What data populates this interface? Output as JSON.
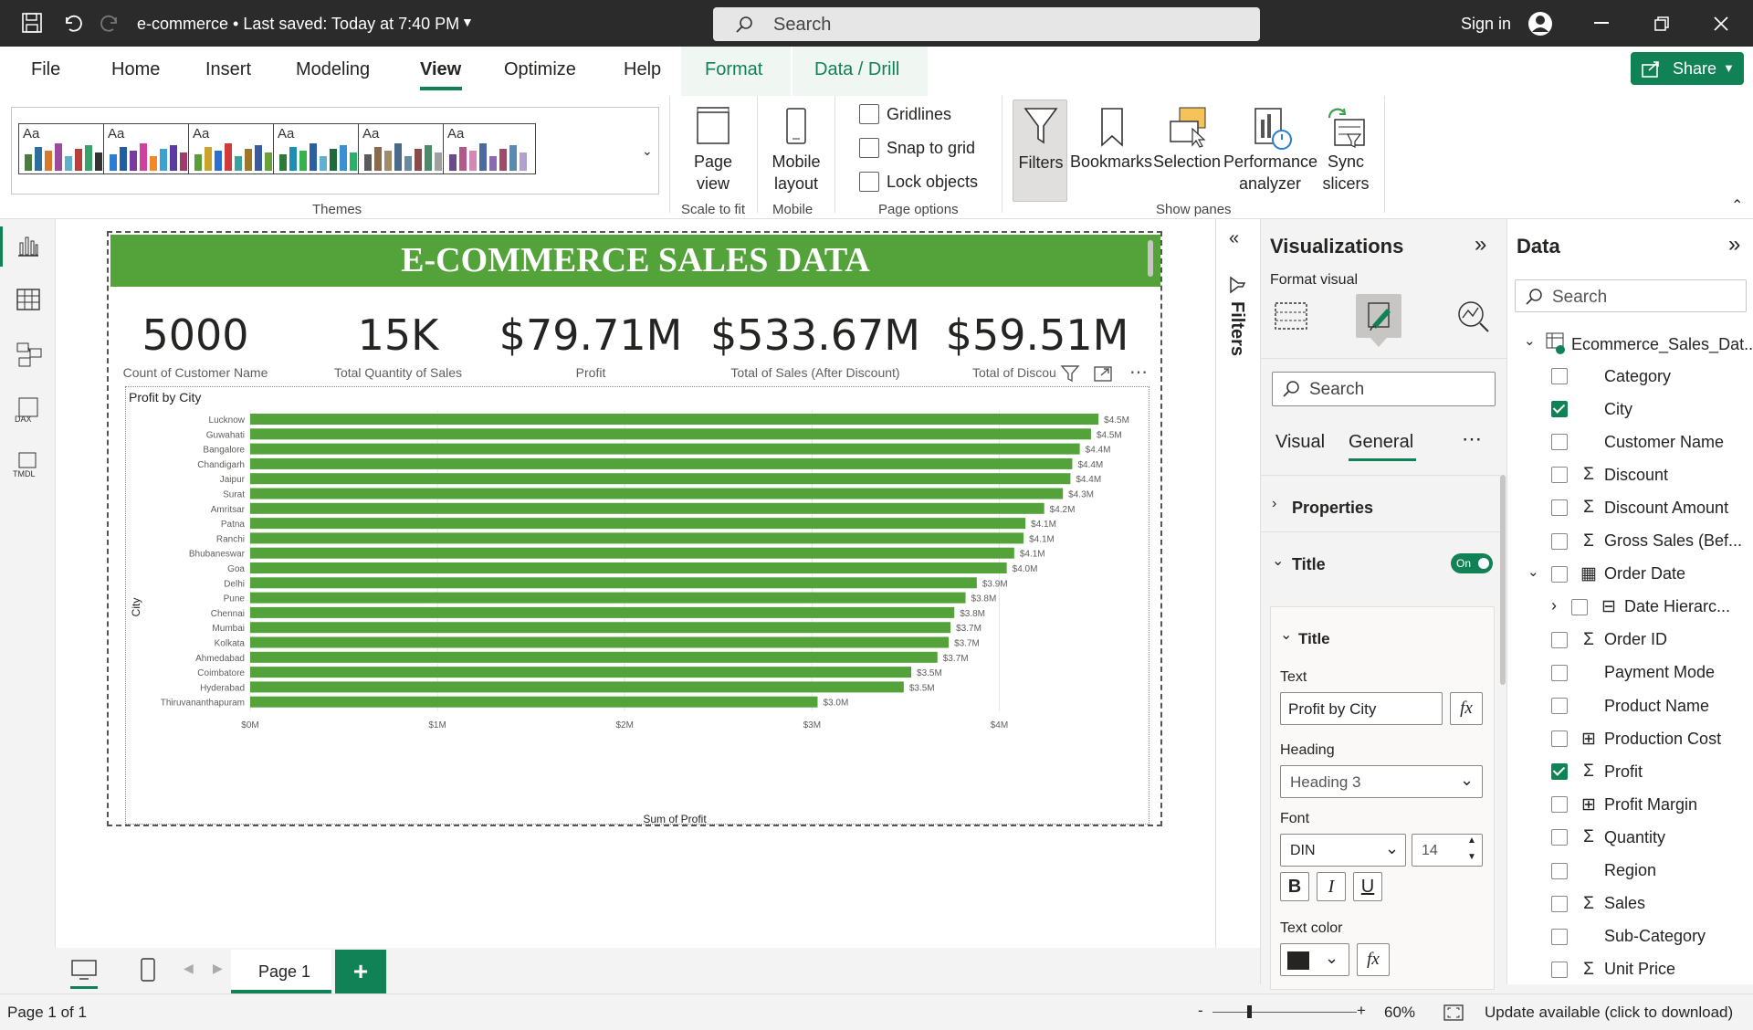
{
  "titlebar": {
    "doc_title": "e-commerce • Last saved: Today at 7:40 PM",
    "search_placeholder": "Search",
    "sign_in": "Sign in"
  },
  "menu": {
    "items": [
      "File",
      "Home",
      "Insert",
      "Modeling",
      "View",
      "Optimize",
      "Help",
      "Format",
      "Data / Drill"
    ],
    "active": "View",
    "share": "Share"
  },
  "ribbon": {
    "themes_label": "Themes",
    "page_view": "Page view",
    "scale_to_fit": "Scale to fit",
    "mobile_layout": "Mobile layout",
    "mobile": "Mobile",
    "gridlines": "Gridlines",
    "snap_to_grid": "Snap to grid",
    "lock_objects": "Lock objects",
    "page_options": "Page options",
    "filters": "Filters",
    "bookmarks": "Bookmarks",
    "selection": "Selection",
    "performance_analyzer": "Performance analyzer",
    "sync_slicers": "Sync slicers",
    "show_panes": "Show panes",
    "theme_aa": "Aa"
  },
  "report": {
    "banner": "E-COMMERCE SALES DATA",
    "cards": [
      {
        "value": "5000",
        "label": "Count of Customer Name"
      },
      {
        "value": "15K",
        "label": "Total Quantity of Sales"
      },
      {
        "value": "$79.71M",
        "label": "Profit"
      },
      {
        "value": "$533.67M",
        "label": "Total of Sales (After Discount)"
      },
      {
        "value": "$59.51M",
        "label": "Total of Discou"
      }
    ]
  },
  "chart_data": {
    "type": "bar",
    "orientation": "horizontal",
    "title": "Profit by City",
    "xlabel": "Sum of Profit",
    "ylabel": "City",
    "xlim": [
      0,
      4.5
    ],
    "x_unit": "$M",
    "x_ticks": [
      "$0M",
      "$1M",
      "$2M",
      "$3M",
      "$4M"
    ],
    "categories": [
      "Lucknow",
      "Guwahati",
      "Bangalore",
      "Chandigarh",
      "Jaipur",
      "Surat",
      "Amritsar",
      "Patna",
      "Ranchi",
      "Bhubaneswar",
      "Goa",
      "Delhi",
      "Pune",
      "Chennai",
      "Mumbai",
      "Kolkata",
      "Ahmedabad",
      "Coimbatore",
      "Hyderabad",
      "Thiruvananthapuram"
    ],
    "values": [
      4.53,
      4.49,
      4.43,
      4.39,
      4.38,
      4.34,
      4.24,
      4.14,
      4.13,
      4.08,
      4.04,
      3.88,
      3.82,
      3.76,
      3.74,
      3.73,
      3.67,
      3.53,
      3.49,
      3.03
    ],
    "data_labels": [
      "$4.5M",
      "$4.5M",
      "$4.4M",
      "$4.4M",
      "$4.4M",
      "$4.3M",
      "$4.2M",
      "$4.1M",
      "$4.1M",
      "$4.1M",
      "$4.0M",
      "$3.9M",
      "$3.8M",
      "$3.8M",
      "$3.7M",
      "$3.7M",
      "$3.7M",
      "$3.5M",
      "$3.5M",
      "$3.0M"
    ],
    "bar_color": "#53a23a",
    "grid": true
  },
  "filters_strip": {
    "label": "Filters"
  },
  "viz": {
    "title": "Visualizations",
    "format_visual": "Format visual",
    "search_placeholder": "Search",
    "tab_visual": "Visual",
    "tab_general": "General",
    "properties": "Properties",
    "title_section": "Title",
    "toggle": "On",
    "sub_title": "Title",
    "text_label": "Text",
    "text_value": "Profit by City",
    "heading_label": "Heading",
    "heading_value": "Heading 3",
    "font_label": "Font",
    "font_value": "DIN",
    "font_size": "14",
    "bold": "B",
    "italic": "I",
    "underline": "U",
    "text_color_label": "Text color",
    "fx": "fx",
    "text_color": "#252423"
  },
  "data_pane": {
    "title": "Data",
    "search_placeholder": "Search",
    "table": "Ecommerce_Sales_Dat...",
    "fields": [
      {
        "name": "Category",
        "icon": "",
        "checked": false
      },
      {
        "name": "City",
        "icon": "",
        "checked": true
      },
      {
        "name": "Customer Name",
        "icon": "",
        "checked": false
      },
      {
        "name": "Discount",
        "icon": "sigma",
        "checked": false
      },
      {
        "name": "Discount Amount",
        "icon": "sigma",
        "checked": false
      },
      {
        "name": "Gross Sales (Bef...",
        "icon": "sigma",
        "checked": false
      },
      {
        "name": "Order Date",
        "icon": "calendar",
        "checked": false
      },
      {
        "name": "Date Hierarc...",
        "icon": "hierarchy",
        "checked": false
      },
      {
        "name": "Order ID",
        "icon": "sigma",
        "checked": false
      },
      {
        "name": "Payment Mode",
        "icon": "",
        "checked": false
      },
      {
        "name": "Product Name",
        "icon": "",
        "checked": false
      },
      {
        "name": "Production Cost",
        "icon": "calc",
        "checked": false
      },
      {
        "name": "Profit",
        "icon": "sigma",
        "checked": true
      },
      {
        "name": "Profit Margin",
        "icon": "calc",
        "checked": false
      },
      {
        "name": "Quantity",
        "icon": "sigma",
        "checked": false
      },
      {
        "name": "Region",
        "icon": "",
        "checked": false
      },
      {
        "name": "Sales",
        "icon": "sigma",
        "checked": false
      },
      {
        "name": "Sub-Category",
        "icon": "",
        "checked": false
      },
      {
        "name": "Unit Price",
        "icon": "sigma",
        "checked": false
      }
    ]
  },
  "pages": {
    "tab": "Page 1",
    "add": "+"
  },
  "status": {
    "page_info": "Page 1 of 1",
    "zoom": "60%",
    "update": "Update available (click to download)"
  }
}
